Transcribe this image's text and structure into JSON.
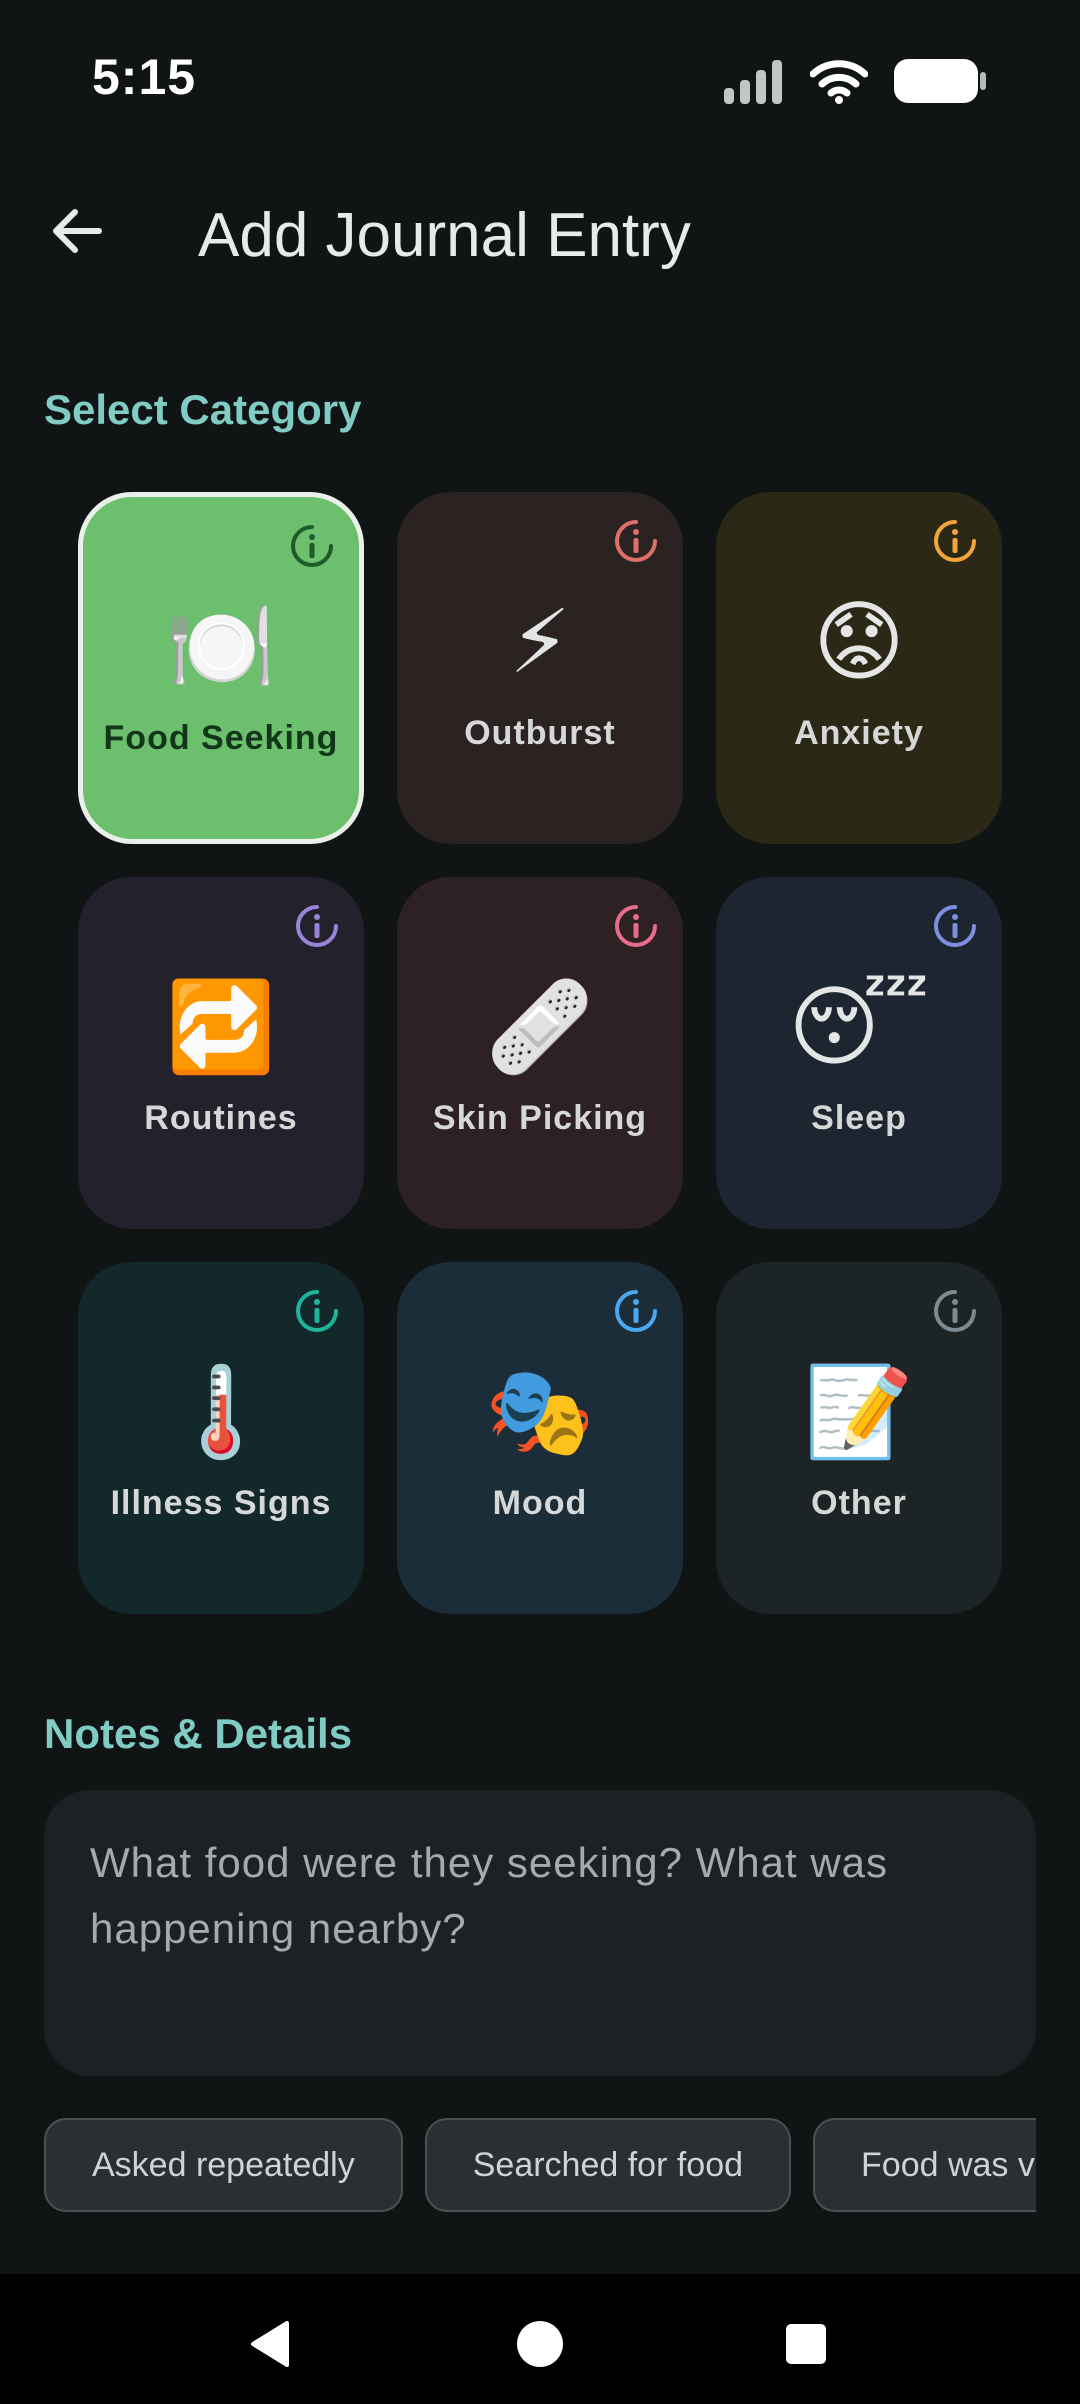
{
  "status_bar": {
    "time": "5:15"
  },
  "app_bar": {
    "title": "Add Journal Entry"
  },
  "select_category": {
    "title": "Select Category",
    "categories": [
      {
        "label": "Food Seeking",
        "emoji": "🍽️",
        "bg": "#6bbf6d",
        "info_color": "#1f5a2a",
        "selected": true
      },
      {
        "label": "Outburst",
        "emoji": "⚡",
        "bg": "#2a2322",
        "info_color": "#e0716a",
        "selected": false
      },
      {
        "label": "Anxiety",
        "emoji": "😟",
        "bg": "#2b2816",
        "info_color": "#f2a63a",
        "selected": false
      },
      {
        "label": "Routines",
        "emoji": "🔁",
        "bg": "#22212c",
        "info_color": "#9a84d8",
        "selected": false
      },
      {
        "label": "Skin Picking",
        "emoji": "🩹",
        "bg": "#2d2124",
        "info_color": "#e86a8c",
        "selected": false
      },
      {
        "label": "Sleep",
        "emoji": "😴",
        "bg": "#1c2530",
        "info_color": "#7f8fe0",
        "selected": false
      },
      {
        "label": "Illness Signs",
        "emoji": "🌡️",
        "bg": "#13282a",
        "info_color": "#1fb59c",
        "selected": false
      },
      {
        "label": "Mood",
        "emoji": "🎭",
        "bg": "#1b2d38",
        "info_color": "#4aa8f0",
        "selected": false
      },
      {
        "label": "Other",
        "emoji": "📝",
        "bg": "#1d2426",
        "info_color": "#7c8b92",
        "selected": false
      }
    ]
  },
  "notes": {
    "title": "Notes & Details",
    "placeholder": "What food were they seeking? What was happening nearby?"
  },
  "quick_chips": [
    "Asked repeatedly",
    "Searched for food",
    "Food was visible"
  ],
  "colors": {
    "accent": "#80cbc4",
    "background": "#111414"
  }
}
